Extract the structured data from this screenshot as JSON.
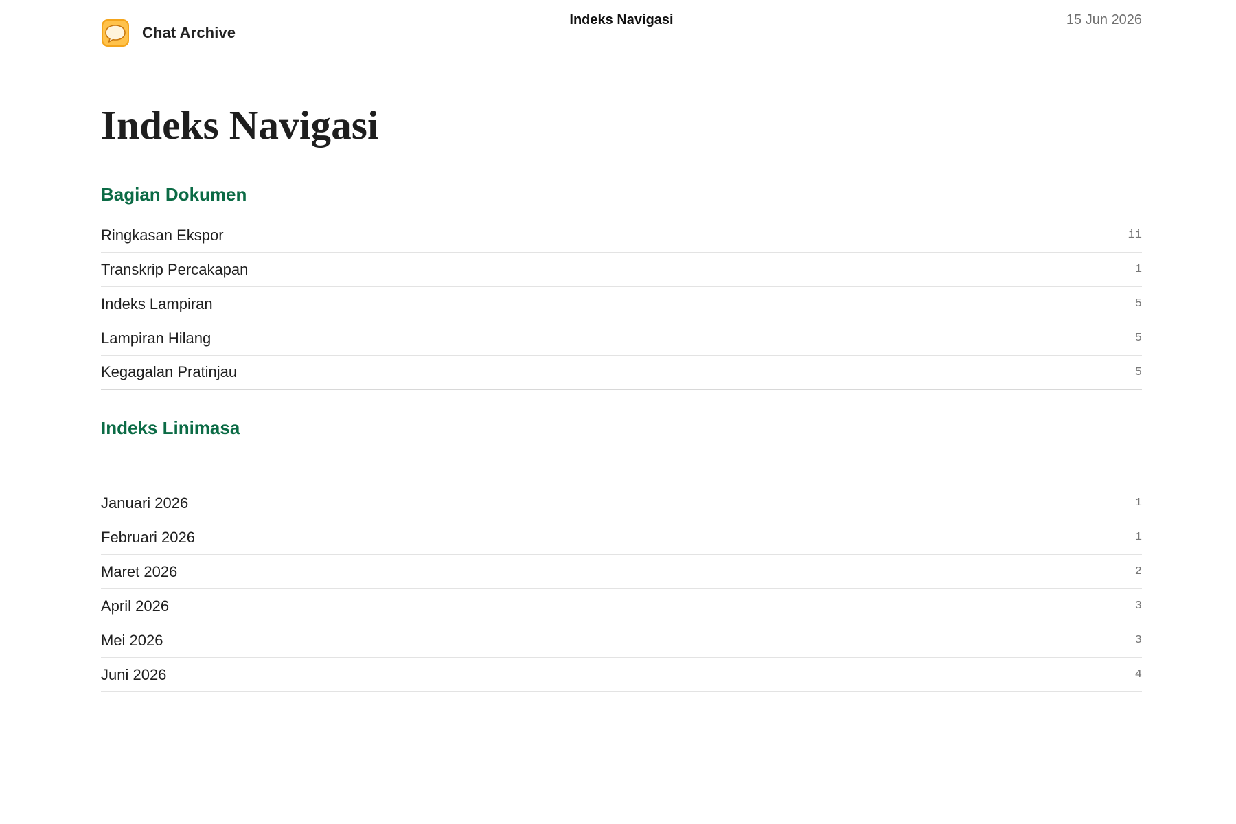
{
  "header": {
    "app_name": "Chat Archive",
    "title": "Indeks Navigasi",
    "date": "15 Jun 2026",
    "icon": "chat-bubble-icon",
    "icon_colors": {
      "outer": "#f4a51c",
      "inner": "#ffc24b",
      "bubble": "#fff4dc"
    }
  },
  "page_title": "Indeks Navigasi",
  "accent_color": "#0b6b45",
  "sections": {
    "heading": "Bagian Dokumen",
    "items": [
      {
        "label": "Ringkasan Ekspor",
        "page": "ii"
      },
      {
        "label": "Transkrip Percakapan",
        "page": "1"
      },
      {
        "label": "Indeks Lampiran",
        "page": "5"
      },
      {
        "label": "Lampiran Hilang",
        "page": "5"
      },
      {
        "label": "Kegagalan Pratinjau",
        "page": "5"
      }
    ]
  },
  "timeline": {
    "heading": "Indeks Linimasa",
    "items": [
      {
        "label": "Januari 2026",
        "page": "1"
      },
      {
        "label": "Februari 2026",
        "page": "1"
      },
      {
        "label": "Maret 2026",
        "page": "2"
      },
      {
        "label": "April 2026",
        "page": "3"
      },
      {
        "label": "Mei 2026",
        "page": "3"
      },
      {
        "label": "Juni 2026",
        "page": "4"
      }
    ]
  }
}
